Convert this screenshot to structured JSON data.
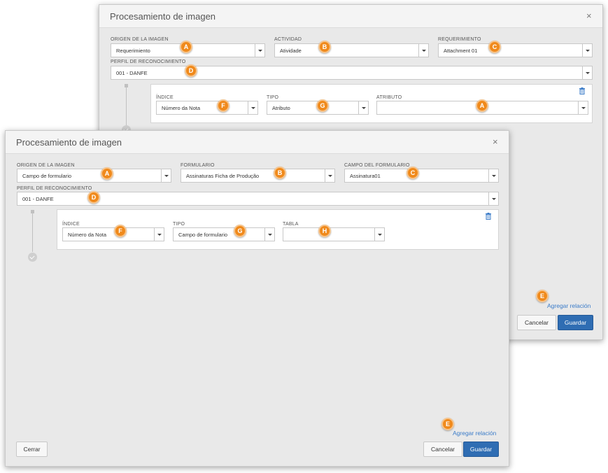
{
  "back": {
    "title": "Procesamiento de imagen",
    "close": "×",
    "origin": {
      "label": "ORIGEN DE LA IMAGEN",
      "value": "Requerimiento",
      "badge": "A"
    },
    "activity": {
      "label": "ACTIVIDAD",
      "value": "Atividade",
      "badge": "B"
    },
    "requirement": {
      "label": "REQUERIMIENTO",
      "value": "Attachment 01",
      "badge": "C"
    },
    "profile": {
      "label": "PERFIL DE RECONOCIMIENTO",
      "value": "001 - DANFE",
      "badge": "D"
    },
    "index": {
      "label": "ÍNDICE",
      "value": "Número da Nota",
      "badge": "F"
    },
    "type": {
      "label": "TIPO",
      "value": "Atributo",
      "badge": "G"
    },
    "attribute": {
      "label": "ATRIBUTO",
      "value": "",
      "badge": "A"
    },
    "add_badge": "E",
    "add_link": "Agregar relación",
    "cancel": "Cancelar",
    "save": "Guardar"
  },
  "front": {
    "title": "Procesamiento de imagen",
    "close": "×",
    "origin": {
      "label": "ORIGEN DE LA IMAGEN",
      "value": "Campo de formulario",
      "badge": "A"
    },
    "form": {
      "label": "FORMULARIO",
      "value": "Assinaturas Ficha de Produção",
      "badge": "B"
    },
    "form_field": {
      "label": "CAMPO DEL FORMULARIO",
      "value": "Assinatura01",
      "badge": "C"
    },
    "profile": {
      "label": "PERFIL DE RECONOCIMIENTO",
      "value": "001 - DANFE",
      "badge": "D"
    },
    "index": {
      "label": "ÍNDICE",
      "value": "Número da Nota",
      "badge": "F"
    },
    "type": {
      "label": "TIPO",
      "value": "Campo de formulario",
      "badge": "G"
    },
    "table": {
      "label": "TABLA",
      "value": "",
      "badge": "H"
    },
    "add_badge": "E",
    "add_link": "Agregar relación",
    "close_btn": "Cerrar",
    "cancel": "Cancelar",
    "save": "Guardar"
  },
  "colors": {
    "badge": "#f08a1c",
    "primary": "#2f6db3",
    "link": "#3a7bc8"
  }
}
